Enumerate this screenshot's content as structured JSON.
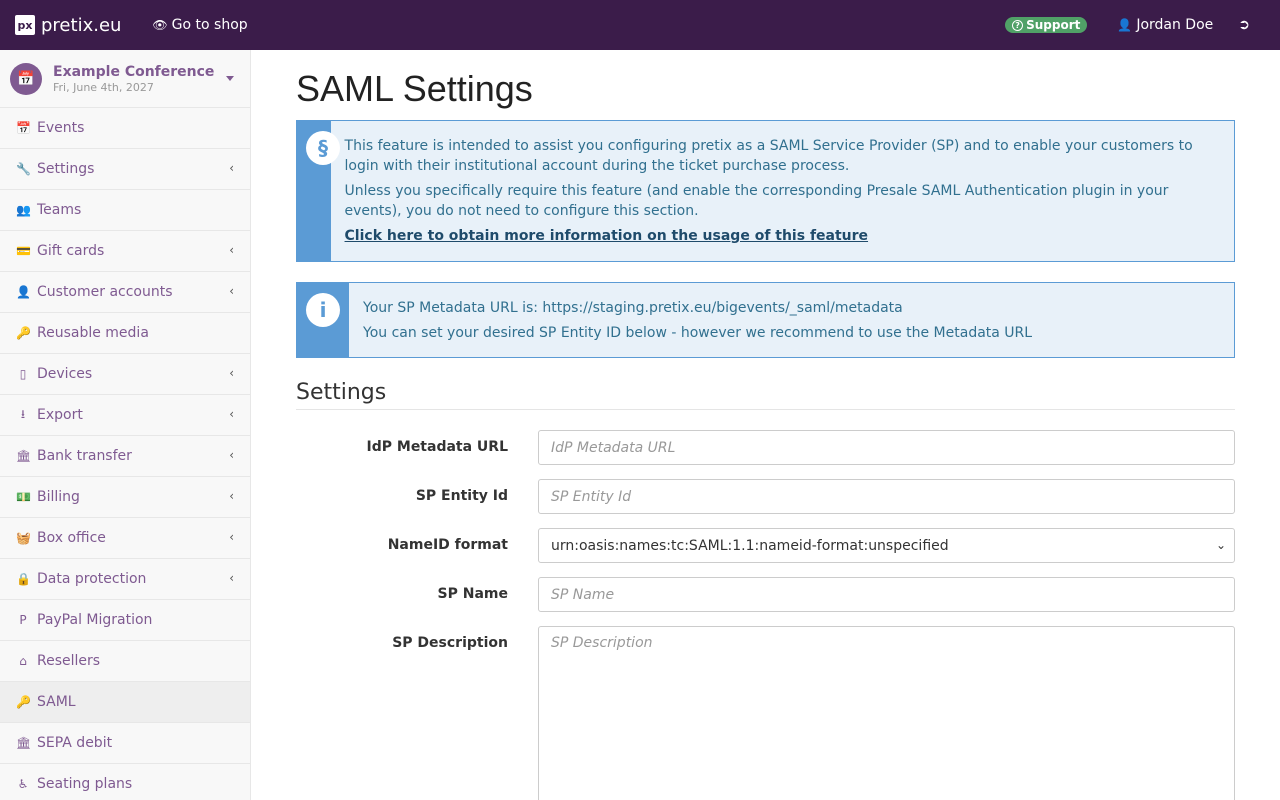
{
  "topbar": {
    "brand": "pretix.eu",
    "go_to_shop": "Go to shop",
    "support": "Support",
    "user": "Jordan Doe"
  },
  "sidebar": {
    "event": {
      "name": "Example Conference",
      "date": "Fri, June 4th, 2027"
    },
    "items": [
      {
        "label": "Events",
        "icon": "calendar-icon",
        "submenu": false
      },
      {
        "label": "Settings",
        "icon": "wrench-icon",
        "submenu": true
      },
      {
        "label": "Teams",
        "icon": "users-icon",
        "submenu": false
      },
      {
        "label": "Gift cards",
        "icon": "credit-card-icon",
        "submenu": true
      },
      {
        "label": "Customer accounts",
        "icon": "user-icon",
        "submenu": true
      },
      {
        "label": "Reusable media",
        "icon": "key-icon",
        "submenu": false
      },
      {
        "label": "Devices",
        "icon": "tablet-icon",
        "submenu": true
      },
      {
        "label": "Export",
        "icon": "download-icon",
        "submenu": true
      },
      {
        "label": "Bank transfer",
        "icon": "bank-icon",
        "submenu": true
      },
      {
        "label": "Billing",
        "icon": "money-icon",
        "submenu": true
      },
      {
        "label": "Box office",
        "icon": "basket-icon",
        "submenu": true
      },
      {
        "label": "Data protection",
        "icon": "lock-icon",
        "submenu": true
      },
      {
        "label": "PayPal Migration",
        "icon": "paypal-icon",
        "submenu": false
      },
      {
        "label": "Resellers",
        "icon": "home-icon",
        "submenu": false
      },
      {
        "label": "SAML",
        "icon": "key-icon",
        "submenu": false,
        "active": true
      },
      {
        "label": "SEPA debit",
        "icon": "bank-icon",
        "submenu": false
      },
      {
        "label": "Seating plans",
        "icon": "wheelchair-icon",
        "submenu": false
      }
    ]
  },
  "main": {
    "title": "SAML Settings",
    "callout1": {
      "p1": "This feature is intended to assist you configuring pretix as a SAML Service Provider (SP) and to enable your customers to login with their institutional account during the ticket purchase process.",
      "p2": "Unless you specifically require this feature (and enable the corresponding Presale SAML Authentication plugin in your events), you do not need to configure this section.",
      "link": "Click here to obtain more information on the usage of this feature"
    },
    "callout2": {
      "p1": "Your SP Metadata URL is: https://staging.pretix.eu/bigevents/_saml/metadata",
      "p2": "You can set your desired SP Entity ID below - however we recommend to use the Metadata URL"
    },
    "section": "Settings",
    "fields": {
      "idp_url": {
        "label": "IdP Metadata URL",
        "placeholder": "IdP Metadata URL",
        "value": ""
      },
      "sp_entity": {
        "label": "SP Entity Id",
        "placeholder": "SP Entity Id",
        "value": ""
      },
      "nameid": {
        "label": "NameID format",
        "value": "urn:oasis:names:tc:SAML:1.1:nameid-format:unspecified"
      },
      "sp_name": {
        "label": "SP Name",
        "placeholder": "SP Name",
        "value": ""
      },
      "sp_desc": {
        "label": "SP Description",
        "placeholder": "SP Description",
        "value": ""
      }
    }
  }
}
